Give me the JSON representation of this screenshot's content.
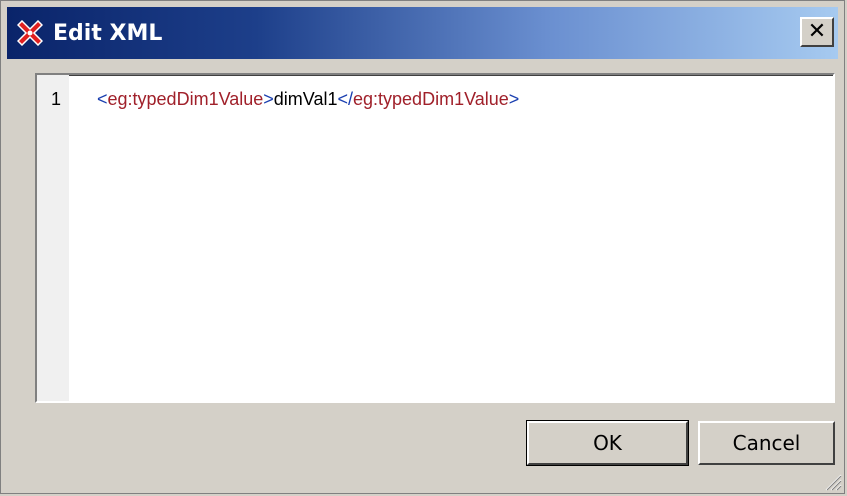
{
  "window": {
    "title": "Edit XML",
    "close_label": "✕"
  },
  "editor": {
    "line_number": "1",
    "line": {
      "open_lt": "<",
      "open_tag": "eg:typedDim1Value",
      "open_gt": ">",
      "value": "dimVal1",
      "close_lt": "</",
      "close_tag": "eg:typedDim1Value",
      "close_gt": ">"
    }
  },
  "buttons": {
    "ok": "OK",
    "cancel": "Cancel"
  },
  "colors": {
    "tag": "#a0202a",
    "bracket": "#1a3fb0",
    "text": "#000000",
    "titlebar_start": "#0a246a",
    "titlebar_end": "#a6caf0"
  },
  "icons": {
    "app": "xmlspy-x-icon",
    "close": "close-icon",
    "grip": "resize-grip-icon"
  }
}
